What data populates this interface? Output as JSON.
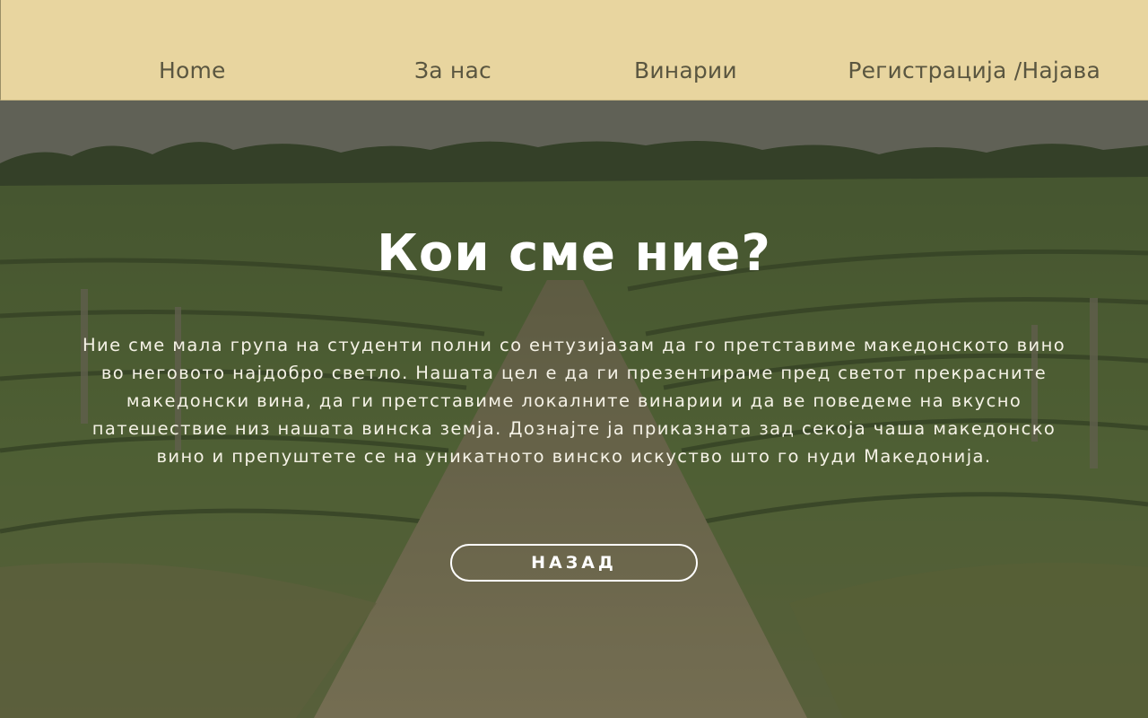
{
  "nav": {
    "home": "Home",
    "about": "За нас",
    "wineries": "Винарии",
    "auth": "Регистрација /Најава"
  },
  "hero": {
    "title": "Кои сме ние?",
    "text": "Ние сме мала група на студенти полни со ентузијазам да го претставиме македонското вино во неговото најдобро светло. Нашата цел е да ги презентираме пред светот прекрасните македонски вина, да ги претставиме локалните винарии и да ве поведеме на вкусно патешествие низ нашата винска земја. Дознајте ја приказната зад секоја чаша македонско вино и препуштете се на уникатното винско искуство што го нуди Македонија.",
    "back_button": "НАЗАД"
  },
  "colors": {
    "navbar_bg": "#e8d59f",
    "nav_text": "#5a5640",
    "hero_text": "#ffffff"
  }
}
